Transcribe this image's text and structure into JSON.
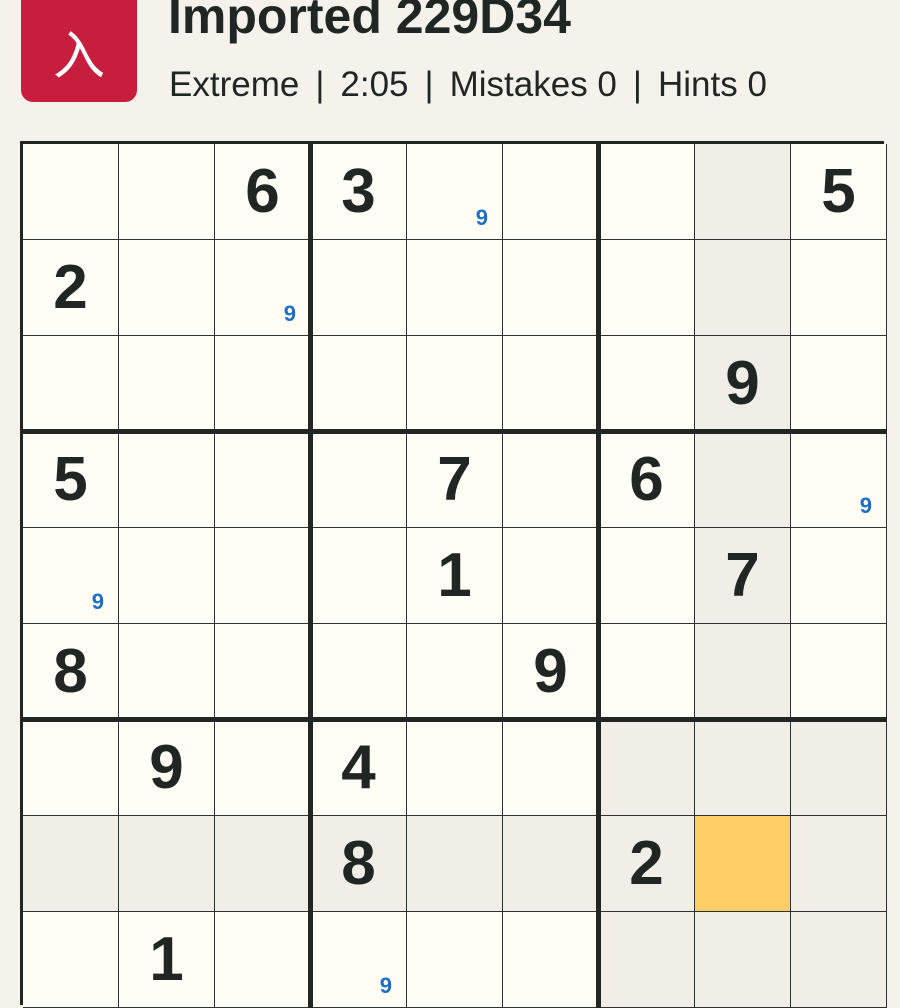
{
  "header": {
    "logo_glyph": "入",
    "title": "Imported 229D34",
    "difficulty": "Extreme",
    "timer": "2:05",
    "mistakes": "Mistakes 0",
    "hints": "Hints 0",
    "separator": "|"
  },
  "colors": {
    "logo_bg": "#c81e3e",
    "selected_cell": "#ffcf66",
    "highlight_cell": "#f0eee6",
    "note_color": "#1b6fc4",
    "given_color": "#1f2624"
  },
  "board": {
    "selected": [
      7,
      7
    ],
    "highlighted": [
      [
        7,
        0
      ],
      [
        7,
        1
      ],
      [
        7,
        2
      ],
      [
        7,
        3
      ],
      [
        7,
        4
      ],
      [
        7,
        5
      ],
      [
        7,
        6
      ],
      [
        7,
        8
      ],
      [
        0,
        7
      ],
      [
        1,
        7
      ],
      [
        2,
        7
      ],
      [
        3,
        7
      ],
      [
        4,
        7
      ],
      [
        5,
        7
      ],
      [
        6,
        7
      ],
      [
        8,
        7
      ],
      [
        6,
        6
      ],
      [
        6,
        8
      ],
      [
        8,
        6
      ],
      [
        8,
        8
      ]
    ],
    "givens": [
      [
        "",
        "",
        "6",
        "3",
        "",
        "",
        "",
        "",
        "5"
      ],
      [
        "2",
        "",
        "",
        "",
        "",
        "",
        "",
        "",
        ""
      ],
      [
        "",
        "",
        "",
        "",
        "",
        "",
        "",
        "9",
        ""
      ],
      [
        "5",
        "",
        "",
        "",
        "7",
        "",
        "6",
        "",
        ""
      ],
      [
        "",
        "",
        "",
        "",
        "1",
        "",
        "",
        "7",
        ""
      ],
      [
        "8",
        "",
        "",
        "",
        "",
        "9",
        "",
        "",
        ""
      ],
      [
        "",
        "9",
        "",
        "4",
        "",
        "",
        "",
        "",
        ""
      ],
      [
        "",
        "",
        "",
        "8",
        "",
        "",
        "2",
        "",
        ""
      ],
      [
        "",
        "1",
        "",
        "",
        "",
        "",
        "",
        "",
        ""
      ]
    ],
    "notes": [
      {
        "row": 0,
        "col": 4,
        "value": "9"
      },
      {
        "row": 1,
        "col": 2,
        "value": "9"
      },
      {
        "row": 3,
        "col": 8,
        "value": "9"
      },
      {
        "row": 4,
        "col": 0,
        "value": "9"
      },
      {
        "row": 8,
        "col": 3,
        "value": "9"
      }
    ]
  }
}
